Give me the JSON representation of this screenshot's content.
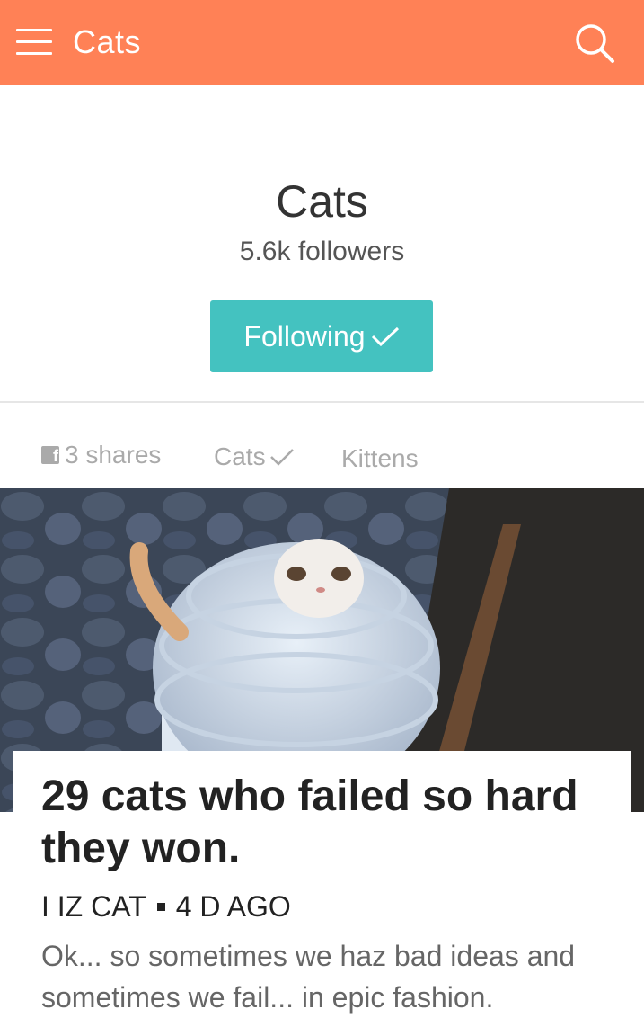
{
  "header": {
    "title": "Cats",
    "menu_icon": "hamburger-menu-icon",
    "search_icon": "search-icon",
    "background_color": "#ff8156"
  },
  "profile": {
    "title": "Cats",
    "followers": "5.6k followers",
    "follow_button_label": "Following",
    "follow_button_color": "#44c2c0"
  },
  "meta": {
    "shares": "3 shares",
    "tags": [
      "Cats",
      "Kittens"
    ]
  },
  "article": {
    "title": "29 cats who failed so hard they won.",
    "author": "I IZ CAT",
    "age": "4 D AGO",
    "excerpt": "Ok... so sometimes we haz bad ideas and sometimes we fail... in epic fashion."
  }
}
